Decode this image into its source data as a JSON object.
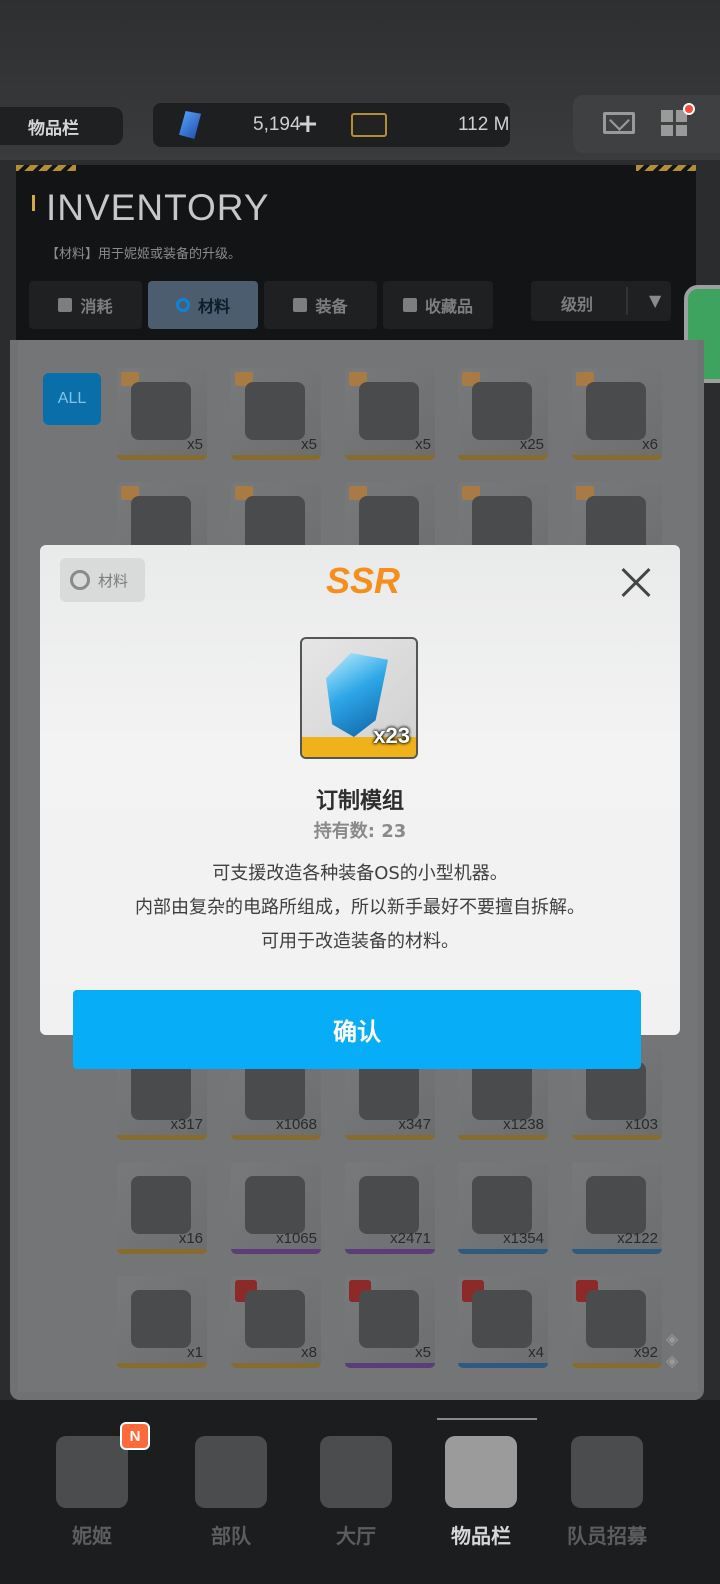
{
  "topbar": {
    "page_tab": "物品栏",
    "gem_value": "5,194",
    "gem_plus": "+",
    "credit_value": "112 M",
    "gem_icon": "gem-icon",
    "credit_icon": "credit-icon",
    "mail_icon": "mail-icon",
    "menu_icon": "grid-menu-icon"
  },
  "inventory": {
    "title": "INVENTORY",
    "description": "【材料】用于妮姬或装备的升级。",
    "tabs": [
      {
        "label": "消耗",
        "icon": "consumable-icon"
      },
      {
        "label": "材料",
        "icon": "material-icon"
      },
      {
        "label": "装备",
        "icon": "equipment-icon"
      },
      {
        "label": "收藏品",
        "icon": "collectible-icon"
      }
    ],
    "active_tab": "材料",
    "sort_label": "级别",
    "sort_arrow": "▼",
    "filter_all": "ALL",
    "visible_quantities": {
      "row1": [
        "x5",
        "x5",
        "x5",
        "x25",
        "x6"
      ],
      "row_mid": [
        "x317",
        "x1068",
        "x347",
        "x1238",
        "x103"
      ],
      "row_mid2": [
        "x16",
        "x1065",
        "x2471",
        "x1354",
        "x2122"
      ],
      "row_last": [
        "x1",
        "x8",
        "x5",
        "x4",
        "x92"
      ]
    }
  },
  "modal": {
    "category_tag": "材料",
    "rarity": "SSR",
    "item_quantity": "x23",
    "item_name": "订制模组",
    "owned_label": "持有数: 23",
    "description_lines": [
      "可支援改造各种装备OS的小型机器。",
      "内部由复杂的电路所组成，所以新手最好不要擅自拆解。",
      "可用于改造装备的材料。"
    ],
    "confirm_label": "确认"
  },
  "bottom_nav": {
    "items": [
      {
        "label": "妮姬",
        "icon": "nikke-icon",
        "badge": "N"
      },
      {
        "label": "部队",
        "icon": "squad-icon"
      },
      {
        "label": "大厅",
        "icon": "lobby-icon"
      },
      {
        "label": "物品栏",
        "icon": "inventory-icon"
      },
      {
        "label": "队员招募",
        "icon": "recruit-icon"
      }
    ],
    "active": "物品栏"
  },
  "colors": {
    "rarity": "#f58e1b",
    "confirm": "#08adf8",
    "active_tab": "#4c5d70"
  }
}
